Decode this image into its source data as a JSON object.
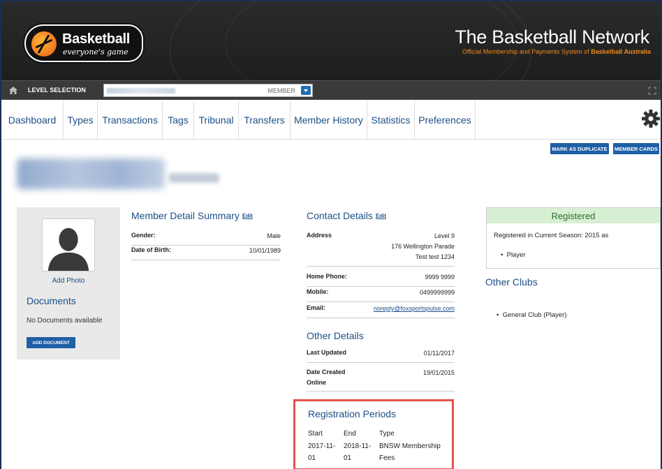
{
  "header": {
    "logo_name": "Basketball",
    "logo_tagline": "everyone's game",
    "brand_title": "The Basketball Network",
    "brand_subtitle_prefix": "Official Membership and Payments System of ",
    "brand_subtitle_strong": "Basketball Australia"
  },
  "levelbar": {
    "label": "LEVEL SELECTION",
    "selected_value": "MEMBER"
  },
  "nav": {
    "tabs": [
      "Dashboard",
      "Types",
      "Transactions",
      "Tags",
      "Tribunal",
      "Transfers",
      "Member History",
      "Statistics",
      "Preferences"
    ]
  },
  "actions": {
    "mark_duplicate": "MARK AS DUPLICATE",
    "member_cards": "MEMBER CARDS"
  },
  "left_panel": {
    "add_photo": "Add Photo",
    "documents_title": "Documents",
    "documents_empty": "No Documents available",
    "add_document": "ADD DOCUMENT"
  },
  "member_detail": {
    "title": "Member Detail Summary",
    "edit": "Edit",
    "gender_label": "Gender:",
    "gender_value": "Male",
    "dob_label": "Date of Birth:",
    "dob_value": "10/01/1989"
  },
  "contact": {
    "title": "Contact Details",
    "edit": "Edit",
    "address_label": "Address",
    "address_line1": "Level 9",
    "address_line2": "176 Wellington Parade",
    "address_line3": "Test test 1234",
    "home_phone_label": "Home Phone:",
    "home_phone_value": "9999 9999",
    "mobile_label": "Mobile:",
    "mobile_value": "0499999999",
    "email_label": "Email:",
    "email_value": "noreply@foxsportspulse.com"
  },
  "other_details": {
    "title": "Other Details",
    "last_updated_label": "Last Updated",
    "last_updated_value": "01/11/2017",
    "date_created_label": "Date Created",
    "date_created_label2": "Online",
    "date_created_value": "19/01/2015"
  },
  "registration_periods": {
    "title": "Registration Periods",
    "col_start": "Start",
    "col_end": "End",
    "col_type": "Type",
    "start_line1": "2017-11-",
    "start_line2": "01",
    "end_line1": "2018-11-",
    "end_line2": "01",
    "type_line1": "BNSW Membership",
    "type_line2": "Fees"
  },
  "registered": {
    "title": "Registered",
    "text": "Registered in Current Season: 2015 as",
    "item": "Player"
  },
  "other_clubs": {
    "title": "Other Clubs",
    "item": "General Club (Player)"
  },
  "colors": {
    "nav_text": "#1c4f86",
    "button": "#1f5fa5",
    "highlight": "#e8504f",
    "registered_bg": "#d7efd2",
    "brand_orange": "#f08a1c"
  },
  "icons": [
    "home-icon",
    "dropdown-icon",
    "expand-icon",
    "gear-icon",
    "avatar-placeholder-icon"
  ]
}
